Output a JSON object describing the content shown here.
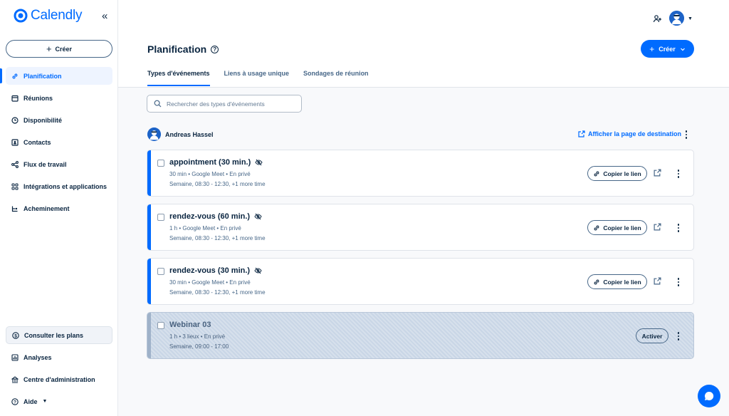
{
  "brand": {
    "name": "Calendly",
    "accent": "#006bff"
  },
  "sidebar": {
    "collapse_label": "«",
    "create_label": "Créer",
    "items": [
      {
        "label": "Planification",
        "icon": "link-icon",
        "active": true
      },
      {
        "label": "Réunions",
        "icon": "calendar-icon"
      },
      {
        "label": "Disponibilité",
        "icon": "clock-icon"
      },
      {
        "label": "Contacts",
        "icon": "contacts-icon"
      },
      {
        "label": "Flux de travail",
        "icon": "workflow-icon"
      },
      {
        "label": "Intégrations et applications",
        "icon": "apps-grid-icon"
      },
      {
        "label": "Acheminement",
        "icon": "routing-icon"
      }
    ],
    "bottom_items": [
      {
        "label": "Consulter les plans",
        "icon": "dollar-icon"
      },
      {
        "label": "Analyses",
        "icon": "analytics-icon"
      },
      {
        "label": "Centre d'administration",
        "icon": "admin-icon"
      },
      {
        "label": "Aide",
        "icon": "help-icon"
      }
    ]
  },
  "header": {
    "title": "Planification",
    "create_label": "Créer",
    "tabs": [
      {
        "label": "Types d'événements",
        "active": true
      },
      {
        "label": "Liens à usage unique"
      },
      {
        "label": "Sondages de réunion"
      }
    ]
  },
  "search": {
    "placeholder": "Rechercher des types d'événements",
    "value": ""
  },
  "user": {
    "name": "Andreas Hassel",
    "landing_link": "Afficher la page de destination"
  },
  "event_types": [
    {
      "title": "appointment (30 min.)",
      "meta": "30 min • Google Meet • En privé",
      "schedule": "Semaine, 08:30 - 12:30, +1 more time",
      "action": "Copier le lien",
      "disabled": false
    },
    {
      "title": "rendez-vous (60 min.)",
      "meta": "1 h • Google Meet • En privé",
      "schedule": "Semaine, 08:30 - 12:30, +1 more time",
      "action": "Copier le lien",
      "disabled": false
    },
    {
      "title": "rendez-vous (30 min.)",
      "meta": "30 min • Google Meet • En privé",
      "schedule": "Semaine, 08:30 - 12:30, +1 more time",
      "action": "Copier le lien",
      "disabled": false
    },
    {
      "title": "Webinar 03",
      "meta": "1 h • 3 lieux • En privé",
      "schedule": "Semaine, 09:00 - 17:00",
      "action": "Activer",
      "disabled": true
    }
  ]
}
